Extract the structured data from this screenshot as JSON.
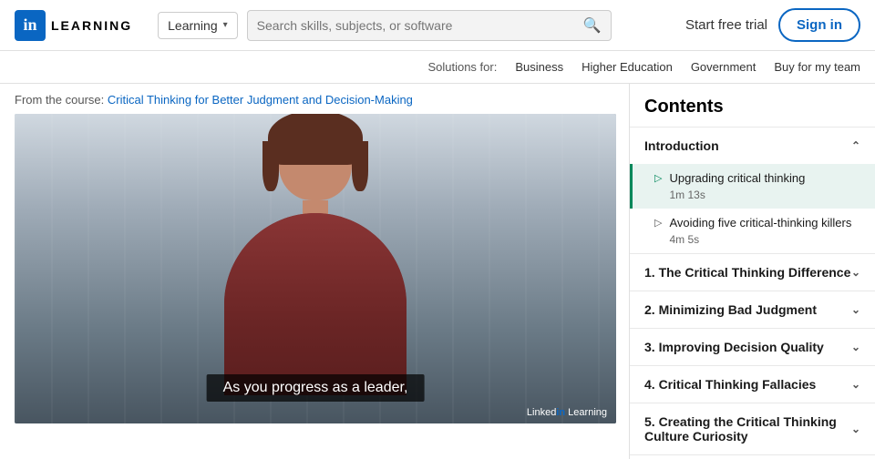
{
  "header": {
    "logo_letter": "in",
    "learning_label": "LEARNING",
    "nav_dropdown": "Learning",
    "search_placeholder": "Search skills, subjects, or software",
    "start_free_trial": "Start free trial",
    "sign_in": "Sign in"
  },
  "subnav": {
    "solutions_label": "Solutions for:",
    "items": [
      {
        "label": "Business"
      },
      {
        "label": "Higher Education"
      },
      {
        "label": "Government"
      },
      {
        "label": "Buy for my team"
      }
    ]
  },
  "breadcrumb": {
    "prefix": "From the course:",
    "course_title": "Critical Thinking for Better Judgment and Decision-Making"
  },
  "video": {
    "subtitle": "As you progress as a leader,",
    "watermark": "Linked Learning"
  },
  "contents": {
    "title": "Contents",
    "sections": [
      {
        "id": "intro",
        "label": "Introduction",
        "expanded": true,
        "lessons": [
          {
            "title": "Upgrading critical thinking",
            "duration": "1m 13s",
            "active": true
          },
          {
            "title": "Avoiding five critical-thinking killers",
            "duration": "4m 5s",
            "active": false
          }
        ]
      },
      {
        "id": "section1",
        "label": "1. The Critical Thinking Difference",
        "expanded": false,
        "lessons": []
      },
      {
        "id": "section2",
        "label": "2. Minimizing Bad Judgment",
        "expanded": false,
        "lessons": []
      },
      {
        "id": "section3",
        "label": "3. Improving Decision Quality",
        "expanded": false,
        "lessons": []
      },
      {
        "id": "section4",
        "label": "4. Critical Thinking Fallacies",
        "expanded": false,
        "lessons": []
      },
      {
        "id": "section5",
        "label": "5. Creating the Critical Thinking Culture Curiosity",
        "expanded": false,
        "lessons": []
      }
    ]
  }
}
